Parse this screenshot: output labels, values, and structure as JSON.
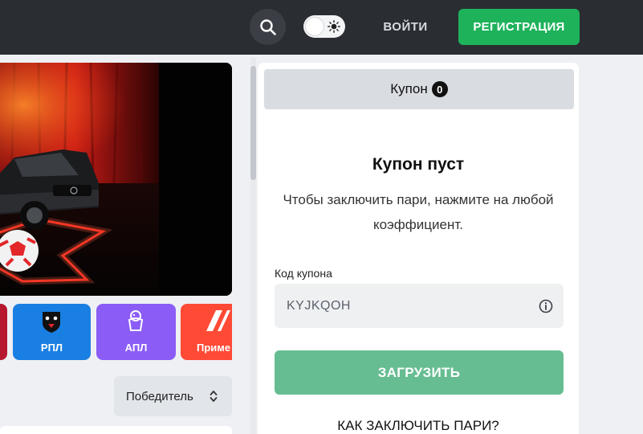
{
  "header": {
    "search_icon": "search-icon",
    "theme_toggle_icon": "sun-icon",
    "login_label": "ВОЙТИ",
    "register_label": "РЕГИСТРАЦИЯ",
    "register_color": "#1eb25b"
  },
  "leagues": [
    {
      "label": "",
      "color": "#b7162f"
    },
    {
      "label": "РПЛ",
      "color": "#1a7fe3",
      "icon": "bear-crest-icon"
    },
    {
      "label": "АПЛ",
      "color": "#8b5cf6",
      "icon": "lion-crest-icon"
    },
    {
      "label": "Приме",
      "color": "#ff4a36",
      "icon": "laliga-logo-icon"
    }
  ],
  "sort": {
    "selected": "Победитель",
    "icon": "sort-arrows-icon"
  },
  "coupon": {
    "tab_label": "Купон",
    "count": "0",
    "empty_title": "Купон пуст",
    "empty_desc": "Чтобы заключить пари, нажмите на любой коэффициент.",
    "code_label": "Код купона",
    "code_value": "KYJKQOH",
    "info_icon": "info-icon",
    "load_label": "ЗАГРУЗИТЬ",
    "load_color": "#67bd92",
    "how_to_label": "КАК ЗАКЛЮЧИТЬ ПАРИ?"
  }
}
